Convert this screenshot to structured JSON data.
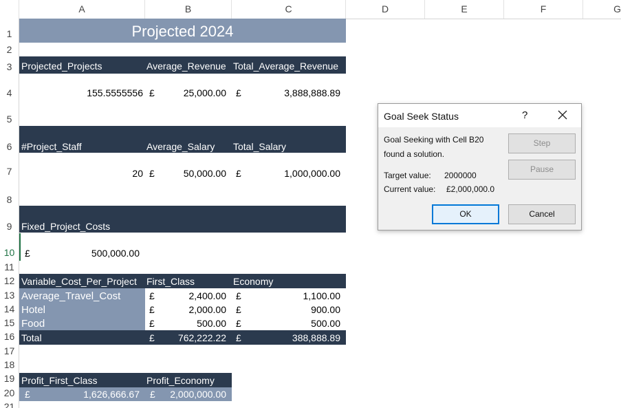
{
  "columns": [
    "A",
    "B",
    "C",
    "D",
    "E",
    "F",
    "G"
  ],
  "rows": [
    "1",
    "2",
    "3",
    "4",
    "5",
    "6",
    "7",
    "8",
    "9",
    "10",
    "11",
    "12",
    "13",
    "14",
    "15",
    "16",
    "17",
    "18",
    "19",
    "20",
    "21"
  ],
  "sheet": {
    "title": "Projected 2024",
    "projects": {
      "headers": [
        "Projected_Projects",
        "Average_Revenue",
        "Total_Average_Revenue"
      ],
      "value": "155.5555556",
      "avg_rev_sym": "£",
      "avg_rev": "25,000.00",
      "total_sym": "£",
      "total": "3,888,888.89"
    },
    "staff": {
      "headers": [
        "#Project_Staff",
        "Average_Salary",
        "Total_Salary"
      ],
      "value": "20",
      "avg_sym": "£",
      "avg": "50,000.00",
      "total_sym": "£",
      "total": "1,000,000.00"
    },
    "fixed": {
      "header": "Fixed_Project_Costs",
      "sym": "£",
      "value": "500,000.00"
    },
    "variable": {
      "headers": [
        "Variable_Cost_Per_Project",
        "First_Class",
        "Economy"
      ],
      "rows": [
        {
          "label": "Average_Travel_Cost",
          "fc_sym": "£",
          "fc": "2,400.00",
          "ec_sym": "£",
          "ec": "1,100.00"
        },
        {
          "label": "Hotel",
          "fc_sym": "£",
          "fc": "2,000.00",
          "ec_sym": "£",
          "ec": "900.00"
        },
        {
          "label": "Food",
          "fc_sym": "£",
          "fc": "500.00",
          "ec_sym": "£",
          "ec": "500.00"
        }
      ],
      "total": {
        "label": "Total",
        "fc_sym": "£",
        "fc": "762,222.22",
        "ec_sym": "£",
        "ec": "388,888.89"
      }
    },
    "profit": {
      "headers": [
        "Profit_First_Class",
        "Profit_Economy"
      ],
      "fc_sym": "£",
      "fc": "1,626,666.67",
      "ec_sym": "£",
      "ec": "2,000,000.00"
    }
  },
  "dialog": {
    "title": "Goal Seek Status",
    "help": "?",
    "line1": "Goal Seeking with Cell B20",
    "line2": "found a solution.",
    "target_label": "Target value:",
    "target_value": "2000000",
    "current_label": "Current value:",
    "current_value": "£2,000,000.0",
    "step": "Step",
    "pause": "Pause",
    "ok": "OK",
    "cancel": "Cancel"
  },
  "colors": {
    "dark": "#2b3a4e",
    "mid": "#8496b0",
    "title_bg": "#8496b0",
    "accent": "#0078d7"
  }
}
